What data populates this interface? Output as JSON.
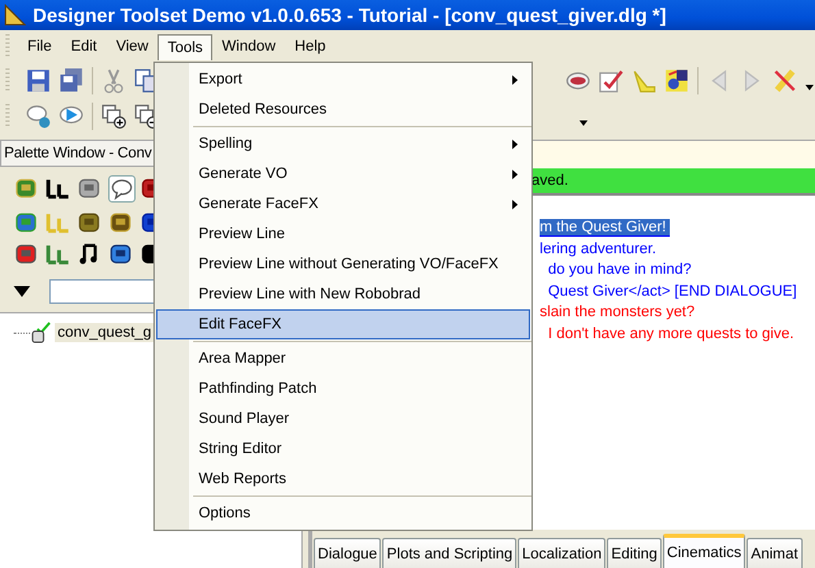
{
  "window": {
    "title": "Designer Toolset Demo v1.0.0.653 - Tutorial - [conv_quest_giver.dlg *]"
  },
  "menubar": [
    {
      "label": "File",
      "selected": false
    },
    {
      "label": "Edit",
      "selected": false
    },
    {
      "label": "View",
      "selected": false
    },
    {
      "label": "Tools",
      "selected": true
    },
    {
      "label": "Window",
      "selected": false
    },
    {
      "label": "Help",
      "selected": false
    }
  ],
  "tools_menu": [
    {
      "kind": "item",
      "label": "Export",
      "submenu": true,
      "selected": false
    },
    {
      "kind": "item",
      "label": "Deleted Resources",
      "submenu": false,
      "selected": false
    },
    {
      "kind": "separator"
    },
    {
      "kind": "item",
      "label": "Spelling",
      "submenu": true,
      "selected": false
    },
    {
      "kind": "item",
      "label": "Generate VO",
      "submenu": true,
      "selected": false
    },
    {
      "kind": "item",
      "label": "Generate FaceFX",
      "submenu": true,
      "selected": false
    },
    {
      "kind": "item",
      "label": "Preview Line",
      "submenu": false,
      "selected": false
    },
    {
      "kind": "item",
      "label": "Preview Line without Generating VO/FaceFX",
      "submenu": false,
      "selected": false
    },
    {
      "kind": "item",
      "label": "Preview Line with New Robobrad",
      "submenu": false,
      "selected": false
    },
    {
      "kind": "item",
      "label": "Edit FaceFX",
      "submenu": false,
      "selected": true
    },
    {
      "kind": "separator"
    },
    {
      "kind": "item",
      "label": "Area Mapper",
      "submenu": false,
      "selected": false
    },
    {
      "kind": "item",
      "label": "Pathfinding Patch",
      "submenu": false,
      "selected": false
    },
    {
      "kind": "item",
      "label": "Sound Player",
      "submenu": false,
      "selected": false
    },
    {
      "kind": "item",
      "label": "String Editor",
      "submenu": false,
      "selected": false
    },
    {
      "kind": "item",
      "label": "Web Reports",
      "submenu": false,
      "selected": false
    },
    {
      "kind": "separator"
    },
    {
      "kind": "item",
      "label": "Options",
      "submenu": false,
      "selected": false
    }
  ],
  "palette": {
    "title": "Palette Window - Conv",
    "tree": [
      {
        "label": "conv_quest_g",
        "checked": true,
        "selected": true
      }
    ]
  },
  "status_bar": {
    "text": "aved."
  },
  "dialogue_lines": [
    {
      "text": "m the Quest Giver!",
      "color": "#0000ff",
      "selected": true
    },
    {
      "text": "lering adventurer.",
      "color": "#0000ff",
      "selected": false
    },
    {
      "text": "  do you have in mind?",
      "color": "#0000ff",
      "selected": false
    },
    {
      "text": "  Quest Giver</act> [END DIALOGUE]",
      "color": "#0000ff",
      "selected": false
    },
    {
      "text": "slain the monsters yet?",
      "color": "#ff0000",
      "selected": false
    },
    {
      "text": "  I don't have any more quests to give.",
      "color": "#ff0000",
      "selected": false
    }
  ],
  "tabs": [
    {
      "label": "Dialogue",
      "selected": false
    },
    {
      "label": "Plots and Scripting",
      "selected": false
    },
    {
      "label": "Localization",
      "selected": false
    },
    {
      "label": "Editing",
      "selected": false
    },
    {
      "label": "Cinematics",
      "selected": true
    },
    {
      "label": "Animat",
      "selected": false
    }
  ]
}
